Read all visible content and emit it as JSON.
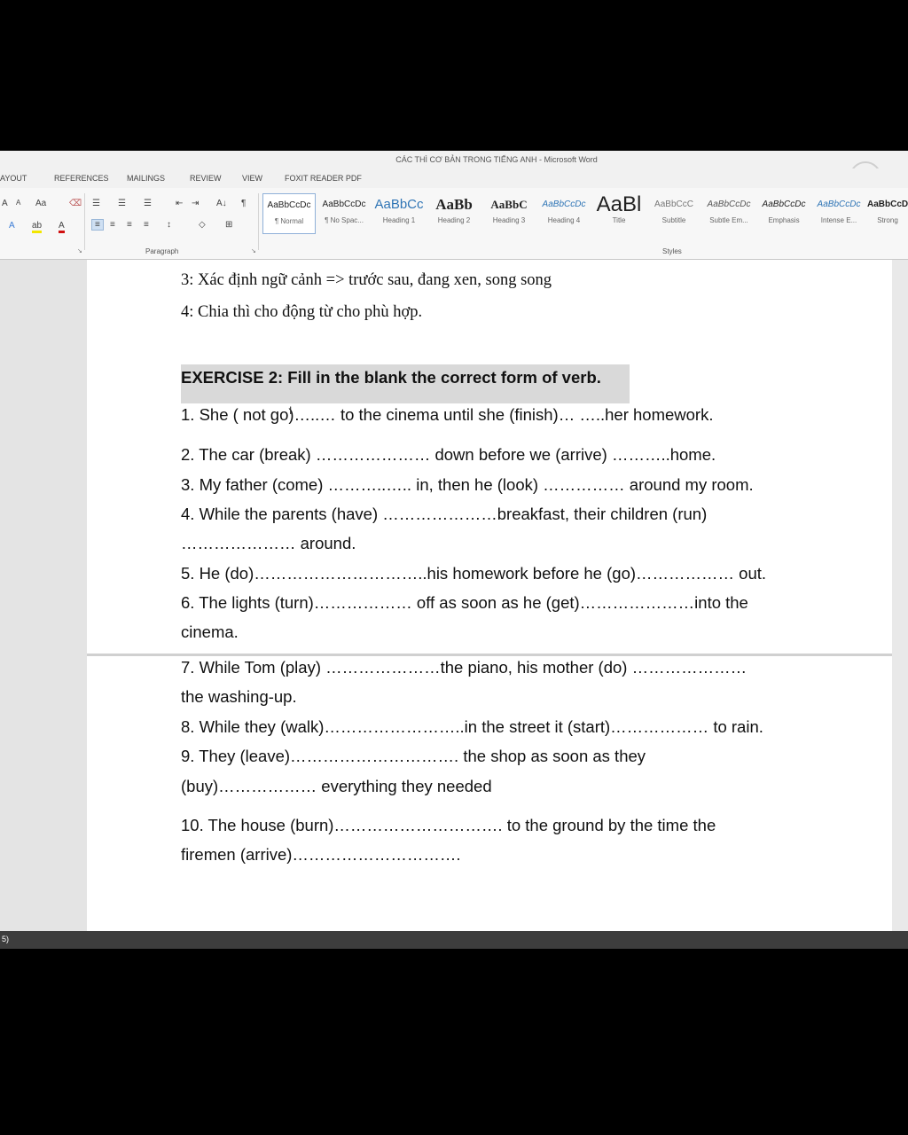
{
  "window": {
    "title": "CÁC THÌ CƠ BẢN TRONG TIẾNG ANH - Microsoft Word"
  },
  "tabs": [
    "AYOUT",
    "REFERENCES",
    "MAILINGS",
    "REVIEW",
    "VIEW",
    "FOXIT READER PDF"
  ],
  "ribbon": {
    "font_row1": {
      "grow": "A",
      "shrink": "A",
      "case": "Aa",
      "clear": "⌫"
    },
    "font_row2": {
      "effects": "A",
      "highlight": "ab",
      "color": "A"
    },
    "paragraph_row1": {
      "bullets": "☰",
      "numbering": "☰",
      "multilevel": "☰",
      "decrease_indent": "⇤",
      "increase_indent": "⇥",
      "sort": "A↓",
      "show_marks": "¶"
    },
    "paragraph_row2": {
      "align_left": "≡",
      "center": "≡",
      "align_right": "≡",
      "justify": "≡",
      "line_spacing": "↕",
      "shading": "◇",
      "borders": "⊞"
    },
    "paragraph_label": "Paragraph",
    "styles_label": "Styles",
    "styles": [
      {
        "sample": "AaBbCcDc",
        "name": "¶ Normal"
      },
      {
        "sample": "AaBbCcDc",
        "name": "¶ No Spac..."
      },
      {
        "sample": "AaBbCc",
        "name": "Heading 1"
      },
      {
        "sample": "AaBb",
        "name": "Heading 2"
      },
      {
        "sample": "AaBbC",
        "name": "Heading 3"
      },
      {
        "sample": "AaBbCcDc",
        "name": "Heading 4"
      },
      {
        "sample": "AaBl",
        "name": "Title"
      },
      {
        "sample": "AaBbCcC",
        "name": "Subtitle"
      },
      {
        "sample": "AaBbCcDc",
        "name": "Subtle Em..."
      },
      {
        "sample": "AaBbCcDc",
        "name": "Emphasis"
      },
      {
        "sample": "AaBbCcDc",
        "name": "Intense E..."
      },
      {
        "sample": "AaBbCcD",
        "name": "Strong"
      }
    ],
    "colors": {
      "highlight": "#f2e600",
      "font_color": "#d01010",
      "heading_blue": "#2e74b5"
    }
  },
  "document": {
    "step3": "3: Xác định ngữ cảnh => trước sau, đang xen, song song",
    "step4": "4: Chia thì cho động từ cho phù hợp.",
    "exercise_title": "EXERCISE 2: Fill in the blank the correct form of verb.",
    "q1": "1. She ( not go)…..… to the cinema until she (finish)… …..her homework.",
    "q2": "2. The car (break) ………………… down before we (arrive) ………..home.",
    "q3": "3. My father (come) ………..….. in, then he (look) …………… around my room.",
    "q4a": "4. While the parents (have) …………………breakfast, their children (run)",
    "q4b": "………………… around.",
    "q5": "5. He (do)…………………………..his homework before he (go)……………… out.",
    "q6a": "6. The lights (turn)……………… off as soon as he (get)…………………into the",
    "q6b": "cinema.",
    "q7a": "7. While Tom (play) …………………the piano, his mother (do) …………………",
    "q7b": "the washing-up.",
    "q8": "8. While they (walk)……………………..in the street it (start)……………… to rain.",
    "q9a": "9. They (leave)…………………………. the shop as soon as they",
    "q9b": "(buy)……………… everything they needed",
    "q10a": "10. The house (burn)…………………………. to the ground by the time the",
    "q10b": "firemen (arrive)…………………………."
  },
  "status": {
    "text": "5)"
  }
}
